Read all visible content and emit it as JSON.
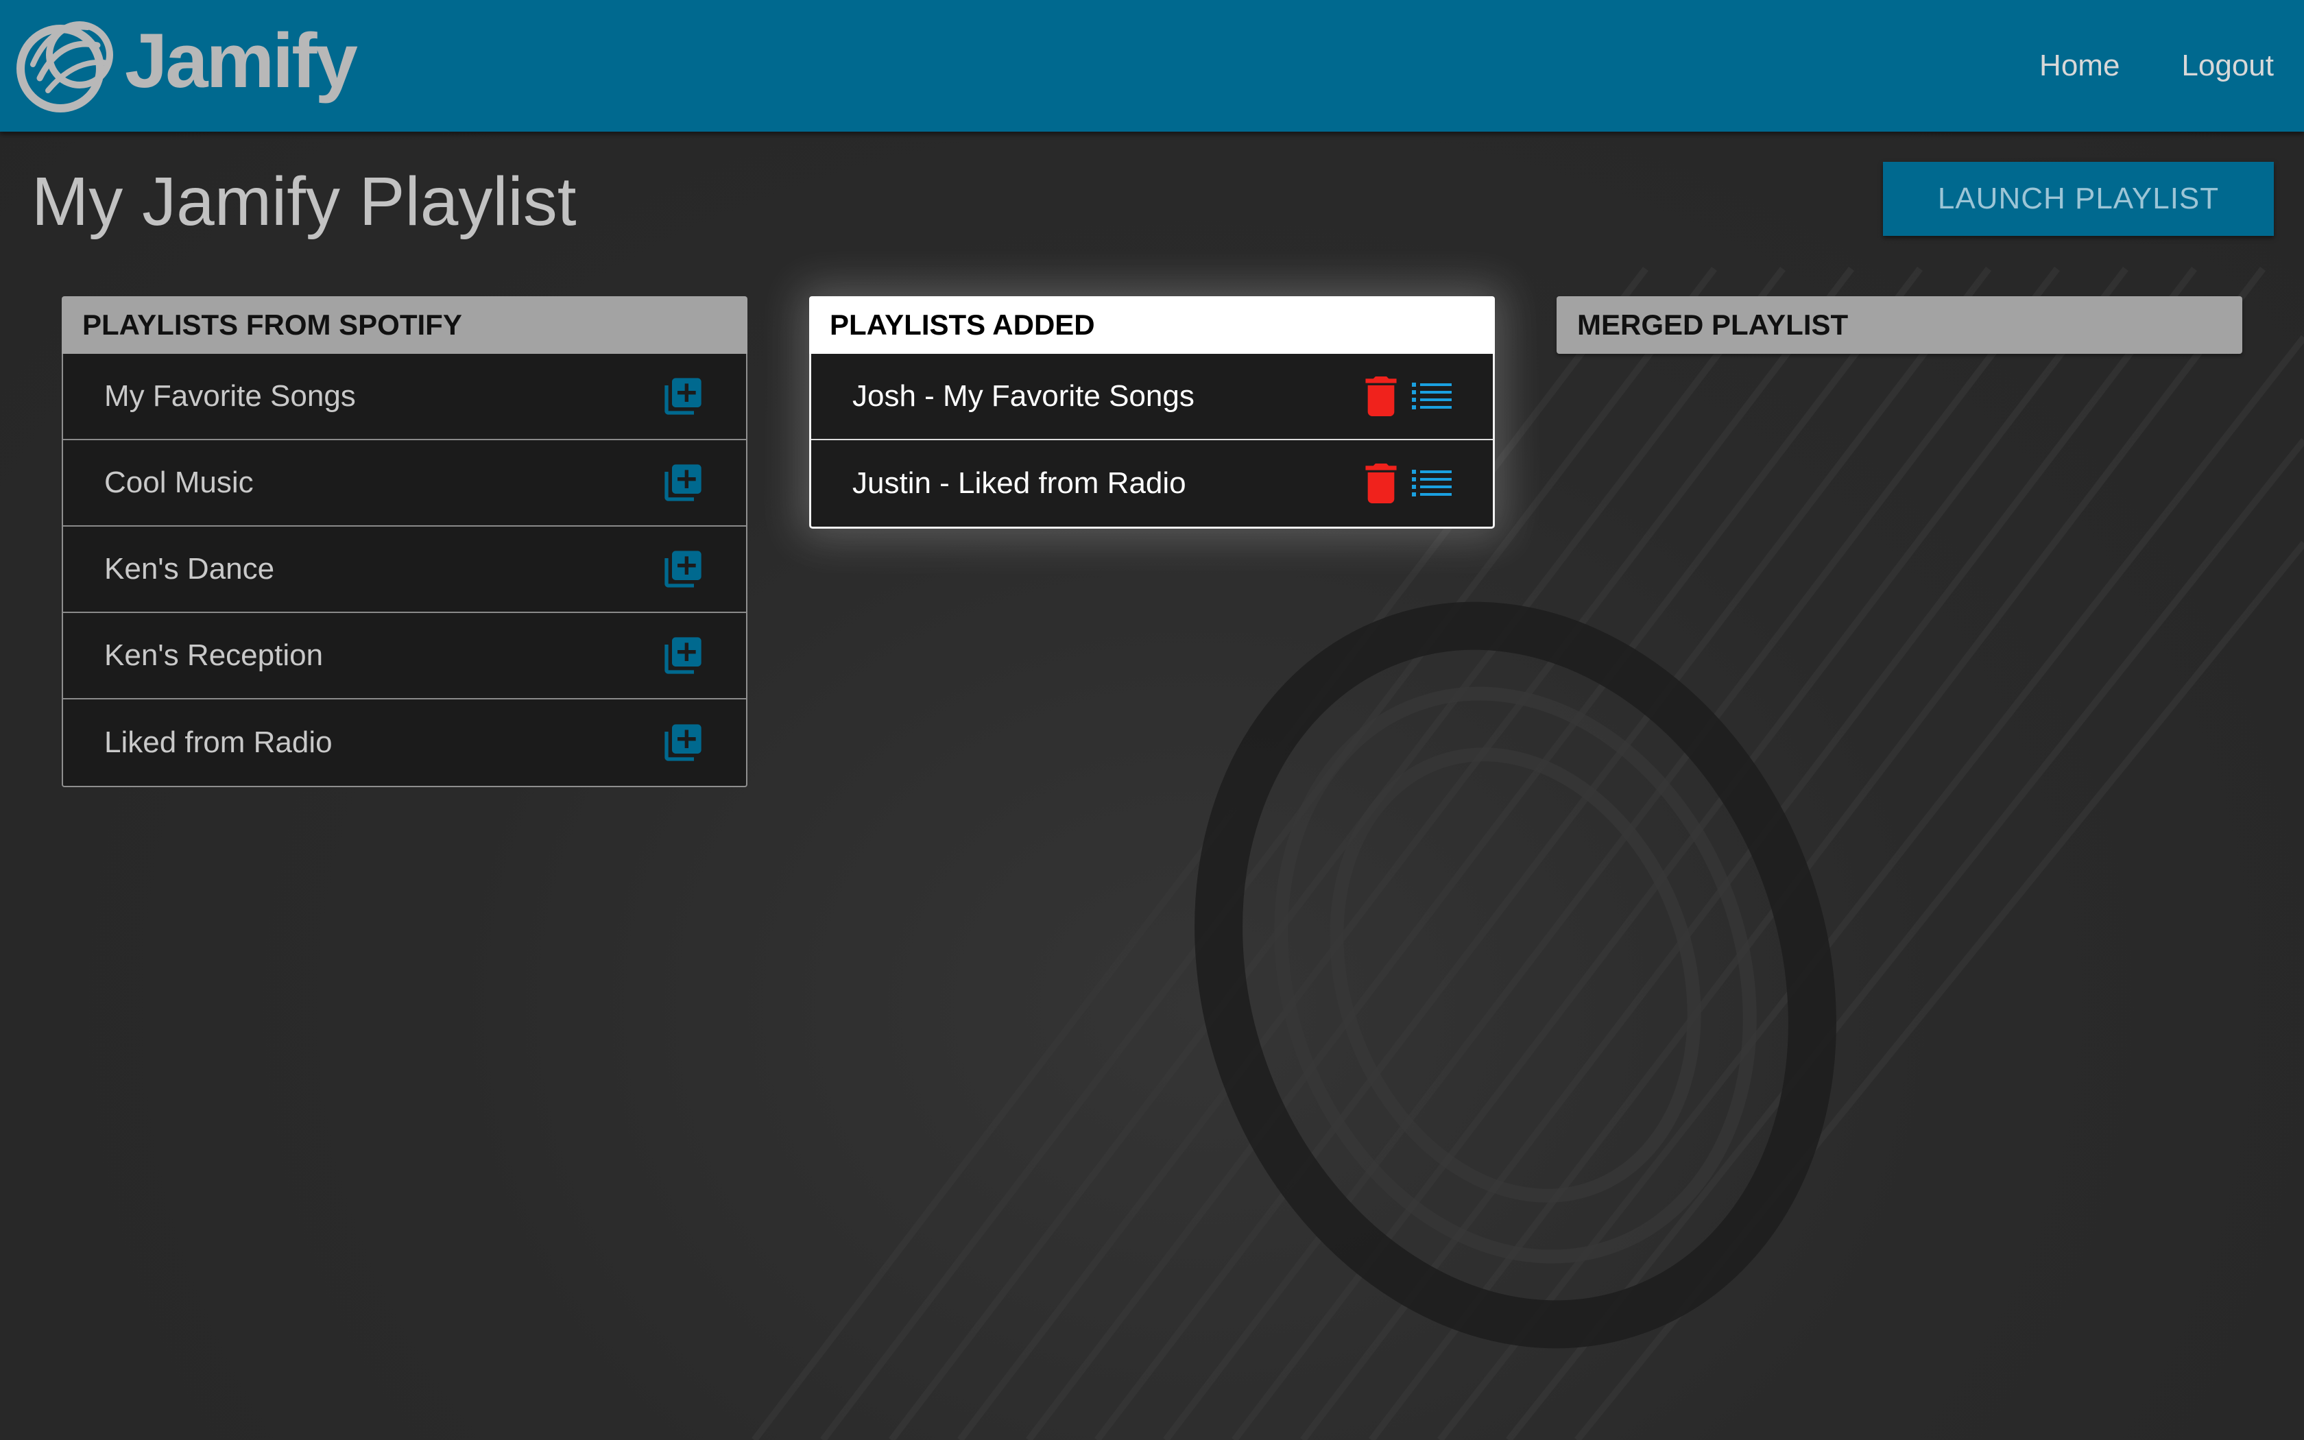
{
  "app": {
    "brand_name": "Jamify",
    "colors": {
      "navbar": "#00698f",
      "accent_icon": "#00698f",
      "delete_icon": "#f0221c",
      "list_icon": "#1aa0e0"
    }
  },
  "nav": {
    "links": [
      {
        "label": "Home",
        "icon": null
      },
      {
        "label": "Logout",
        "icon": null
      }
    ]
  },
  "page": {
    "title": "My Jamify Playlist",
    "launch_button": "LAUNCH PLAYLIST"
  },
  "panels": {
    "spotify": {
      "header": "PLAYLISTS FROM SPOTIFY",
      "item_action_icon": "add-to-library-icon",
      "items": [
        {
          "label": "My Favorite Songs"
        },
        {
          "label": "Cool Music"
        },
        {
          "label": "Ken's Dance"
        },
        {
          "label": "Ken's Reception"
        },
        {
          "label": "Liked from Radio"
        }
      ]
    },
    "added": {
      "header": "PLAYLISTS ADDED",
      "item_action_icons": [
        "trash-icon",
        "list-icon"
      ],
      "items": [
        {
          "label": "Josh - My Favorite Songs"
        },
        {
          "label": "Justin - Liked from Radio"
        }
      ]
    },
    "merged": {
      "header": "MERGED PLAYLIST",
      "items": []
    }
  }
}
